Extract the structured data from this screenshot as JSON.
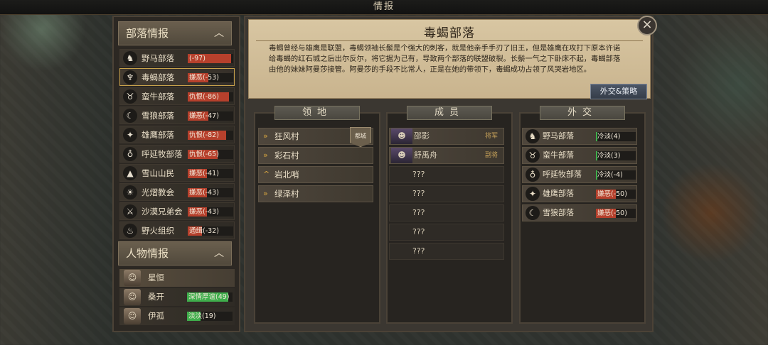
{
  "window_title": "情报",
  "left": {
    "factions_header": "部落情报",
    "chars_header": "人物情报",
    "collapse_icon": "chevron-up-icon",
    "factions": [
      {
        "name": "野马部落",
        "rel": "(-97)",
        "color": "#b6402c",
        "fill": 0.95,
        "icon": "horse-icon"
      },
      {
        "name": "毒蝎部落",
        "rel": "嫌恶(-53)",
        "color": "#b6402c",
        "fill": 0.45,
        "icon": "scorpion-icon",
        "selected": true
      },
      {
        "name": "蛮牛部落",
        "rel": "仇恨(-86)",
        "color": "#b6402c",
        "fill": 0.9,
        "icon": "bull-icon"
      },
      {
        "name": "雪狼部落",
        "rel": "嫌恶(-47)",
        "color": "#b6402c",
        "fill": 0.45,
        "icon": "wolf-icon"
      },
      {
        "name": "雄鹰部落",
        "rel": "仇恨(-82)",
        "color": "#b6402c",
        "fill": 0.85,
        "icon": "eagle-icon"
      },
      {
        "name": "呼延牧部落",
        "rel": "仇恨(-65)",
        "color": "#b6402c",
        "fill": 0.65,
        "icon": "totem-icon"
      },
      {
        "name": "雪山山民",
        "rel": "嫌恶(-41)",
        "color": "#b6402c",
        "fill": 0.42,
        "icon": "mountain-icon"
      },
      {
        "name": "光熠教会",
        "rel": "嫌恶(-43)",
        "color": "#b6402c",
        "fill": 0.42,
        "icon": "sun-icon"
      },
      {
        "name": "沙漠兄弟会",
        "rel": "嫌恶(-43)",
        "color": "#b6402c",
        "fill": 0.42,
        "icon": "crossed-swords-icon"
      },
      {
        "name": "野火组织",
        "rel": "通缉(-32)",
        "color": "#b6402c",
        "fill": 0.32,
        "icon": "flame-icon"
      }
    ],
    "characters": [
      {
        "name": "星恒",
        "rel": ""
      },
      {
        "name": "桑开",
        "rel": "深情厚谊(49)",
        "color": "#3fae4c",
        "fill": 0.9
      },
      {
        "name": "伊孤",
        "rel": "淡淡(19)",
        "color": "#3fae4c",
        "fill": 0.3
      }
    ]
  },
  "faction": {
    "title": "毒蝎部落",
    "description": "毒蝎曾经与雄鹰是联盟，毒蝎领袖长鬃是个强大的刺客，就是他亲手手刃了旧王，但是雄鹰在攻打下原本许诺给毒蝎的红石城之后出尔反尔，将它据为己有，导致两个部落的联盟破裂。长鬃一气之下卧床不起，毒蝎部落由他的妹妹阿曼莎接管。阿曼莎的手段不比常人，正是在她的带领下，毒蝎成功占领了风哭岩地区。",
    "diplomacy_button": "外交&策略"
  },
  "territory": {
    "header": "领地",
    "items": [
      {
        "name": "狂风村",
        "rank": "»",
        "capital": "都城"
      },
      {
        "name": "彩石村",
        "rank": "»"
      },
      {
        "name": "岩北哨",
        "rank": "^"
      },
      {
        "name": "绿泽村",
        "rank": "»"
      }
    ]
  },
  "members": {
    "header": "成员",
    "items": [
      {
        "name": "邵影",
        "role": "将军",
        "known": true
      },
      {
        "name": "舒禹舟",
        "role": "副将",
        "known": true
      },
      {
        "name": "???"
      },
      {
        "name": "???"
      },
      {
        "name": "???"
      },
      {
        "name": "???"
      },
      {
        "name": "???"
      }
    ]
  },
  "diplomacy": {
    "header": "外交",
    "items": [
      {
        "name": "野马部落",
        "rel": "冷淡(4)",
        "color": "#3fae4c",
        "fill": 0.04,
        "icon": "horse-icon"
      },
      {
        "name": "蛮牛部落",
        "rel": "冷淡(3)",
        "color": "#3fae4c",
        "fill": 0.03,
        "icon": "bull-icon"
      },
      {
        "name": "呼延牧部落",
        "rel": "冷淡(-4)",
        "color": "#3fae4c",
        "fill": 0.04,
        "icon": "totem-icon"
      },
      {
        "name": "雄鹰部落",
        "rel": "嫌恶(-50)",
        "color": "#b6402c",
        "fill": 0.5,
        "icon": "eagle-icon"
      },
      {
        "name": "雪狼部落",
        "rel": "嫌恶(-50)",
        "color": "#b6402c",
        "fill": 0.5,
        "icon": "wolf-icon"
      }
    ]
  },
  "close_icon": "close-icon"
}
